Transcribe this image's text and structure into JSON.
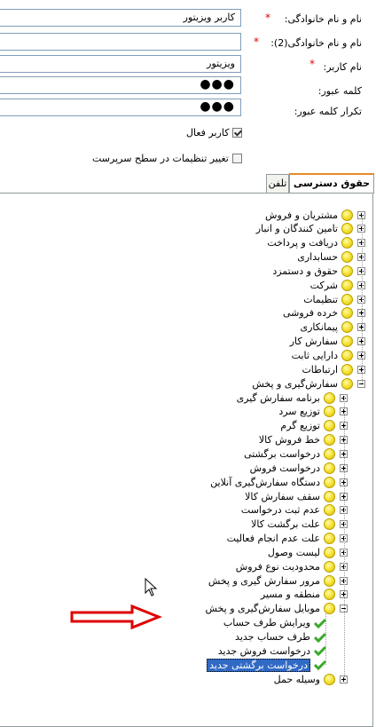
{
  "form": {
    "fullname_label": "نام و نام خانوادگی:",
    "fullname_value": "کاربر ویزیتور",
    "fullname2_label": "نام و نام خانوادگی(2):",
    "fullname2_value": "",
    "username_label": "نام کاربر:",
    "username_value": "ویزیتور",
    "password_label": "کلمه عبور:",
    "password_value": "●●●",
    "confirm_label": "تکرار کلمه عبور:",
    "confirm_value": "●●●",
    "required_mark": "*",
    "active_user_label": "کاربر فعال",
    "active_user_checked": true,
    "server_settings_label": "تغییر تنظیمات در سطح سرپرست",
    "server_settings_checked": false
  },
  "tabs": {
    "access": "حقوق دسترسی",
    "phone": "تلفن"
  },
  "tree": {
    "top_items": [
      "مشتریان و فروش",
      "تامین کنندگان و انبار",
      "دریافت و پرداخت",
      "حسابداری",
      "حقوق و دستمزد",
      "شرکت",
      "تنظیمات",
      "خرده فروشی",
      "پیمانکاری",
      "سفارش کار",
      "دارایی ثابت",
      "ارتباطات"
    ],
    "expanded_item": "سفارش‌گیری و پخش",
    "sub_items": [
      "برنامه سفارش گیری",
      "توزیع سرد",
      "توزیع گرم",
      "خط فروش کالا",
      "درخواست برگشتی",
      "درخواست فروش",
      "دستگاه سفارش‌گیری آنلاین",
      "سقف سفارش کالا",
      "عدم ثبت درخواست",
      "علت برگشت کالا",
      "علت عدم انجام فعالیت",
      "لیست وصول",
      "محدودیت نوع فروش",
      "مرور سفارش گیری و پخش",
      "منطقه و مسیر"
    ],
    "mobile_item": "موبایل سفارش‌گیری و پخش",
    "mobile_children": [
      "ویرایش طرف حساب",
      "طرف حساب جدید",
      "درخواست فروش جدید",
      "درخواست برگشتی جدید"
    ],
    "last_item": "وسیله حمل"
  },
  "colors": {
    "selection": "#316ac5",
    "required": "#e00000",
    "annotation_arrow": "#e00000",
    "tab_accent": "#e68b2c"
  }
}
